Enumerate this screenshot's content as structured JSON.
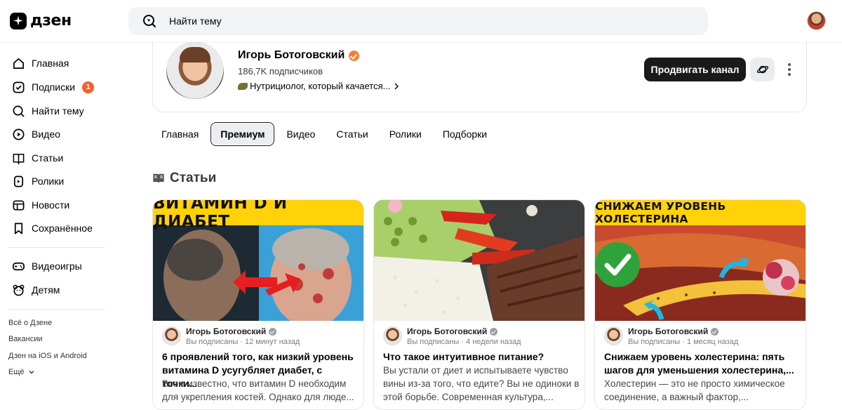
{
  "header": {
    "logo_text": "дзен",
    "search_placeholder": "Найти тему"
  },
  "sidebar": {
    "items": [
      {
        "label": "Главная",
        "icon": "home-icon"
      },
      {
        "label": "Подписки",
        "icon": "subscriptions-icon",
        "badge": "1"
      },
      {
        "label": "Найти тему",
        "icon": "search-icon"
      },
      {
        "label": "Видео",
        "icon": "video-icon"
      },
      {
        "label": "Статьи",
        "icon": "articles-icon"
      },
      {
        "label": "Ролики",
        "icon": "shorts-icon"
      },
      {
        "label": "Новости",
        "icon": "news-icon"
      },
      {
        "label": "Сохранённое",
        "icon": "bookmark-icon"
      }
    ],
    "items2": [
      {
        "label": "Видеоигры",
        "icon": "gamepad-icon"
      },
      {
        "label": "Детям",
        "icon": "kids-icon"
      }
    ],
    "footer": [
      "Всё о Дзене",
      "Вакансии",
      "Дзен на iOS и Android",
      "Ещё"
    ]
  },
  "channel": {
    "name": "Игорь Ботоговский",
    "subscribers": "186,7K подписчиков",
    "description": "Нутрициолог, который качается...",
    "promote_label": "Продвигать канал"
  },
  "tabs": [
    "Главная",
    "Премиум",
    "Видео",
    "Статьи",
    "Ролики",
    "Подборки"
  ],
  "active_tab": "Премиум",
  "section_title": "Статьи",
  "cards": [
    {
      "image_caption": "ВИТАМИН D И ДИАБЕТ",
      "author": "Игорь Ботоговский",
      "meta": "Вы подписаны · 12 минут назад",
      "title": "6 проявлений того, как низкий уровень витамина D усугубляет диабет, с точки...",
      "snippet": "Всем известно, что витамин D необходим для укрепления костей. Однако для люде..."
    },
    {
      "image_caption": "",
      "author": "Игорь Ботоговский",
      "meta": "Вы подписаны · 4 недели назад",
      "title": "Что такое интуитивное питание?",
      "snippet": "Вы устали от диет и испытываете чувство вины из-за того, что едите? Вы не одиноки в этой борьбе. Современная культура,..."
    },
    {
      "image_caption": "СНИЖАЕМ УРОВЕНЬ ХОЛЕСТЕРИНА",
      "author": "Игорь Ботоговский",
      "meta": "Вы подписаны · 1 месяц назад",
      "title": "Снижаем уровень холестерина: пять шагов для уменьшения холестерина,...",
      "snippet": "Холестерин — это не просто химическое соединение, а важный фактор,..."
    }
  ],
  "colors": {
    "accent": "#ff5c26",
    "verified": "#ff7a2a",
    "banner_yellow": "#ffd20a",
    "dark_button": "#1a1a1a"
  }
}
